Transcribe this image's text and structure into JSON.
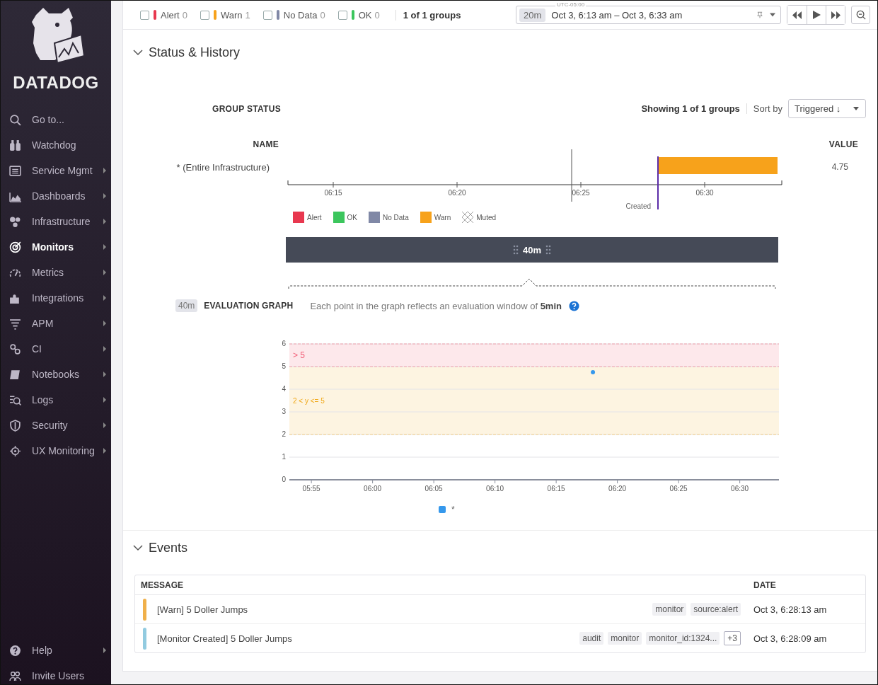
{
  "sidebar": {
    "logo_text": "DATADOG",
    "items": [
      {
        "label": "Go to...",
        "selected": false,
        "submenu": false
      },
      {
        "label": "Watchdog",
        "selected": false,
        "submenu": false
      },
      {
        "label": "Service Mgmt",
        "selected": false,
        "submenu": true
      },
      {
        "label": "Dashboards",
        "selected": false,
        "submenu": true
      },
      {
        "label": "Infrastructure",
        "selected": false,
        "submenu": true
      },
      {
        "label": "Monitors",
        "selected": true,
        "submenu": true
      },
      {
        "label": "Metrics",
        "selected": false,
        "submenu": true
      },
      {
        "label": "Integrations",
        "selected": false,
        "submenu": true
      },
      {
        "label": "APM",
        "selected": false,
        "submenu": true
      },
      {
        "label": "CI",
        "selected": false,
        "submenu": true
      },
      {
        "label": "Notebooks",
        "selected": false,
        "submenu": true
      },
      {
        "label": "Logs",
        "selected": false,
        "submenu": true
      },
      {
        "label": "Security",
        "selected": false,
        "submenu": true
      },
      {
        "label": "UX Monitoring",
        "selected": false,
        "submenu": true
      }
    ],
    "bottom_items": [
      {
        "label": "Help",
        "selected": false,
        "submenu": true
      },
      {
        "label": "Invite Users",
        "selected": false,
        "submenu": false
      }
    ]
  },
  "toolbar": {
    "filters": [
      {
        "label": "Alert",
        "count": "0",
        "checked": false,
        "color": "#e8384f"
      },
      {
        "label": "Warn",
        "count": "1",
        "checked": false,
        "color": "#f7a21b"
      },
      {
        "label": "No Data",
        "count": "0",
        "checked": false,
        "color": "#8088a6"
      },
      {
        "label": "OK",
        "count": "0",
        "checked": false,
        "color": "#3cc65d"
      }
    ],
    "groups": "1 of 1 groups",
    "timeframe": {
      "badge": "20m",
      "timezone": "UTC-05:00",
      "range": "Oct 3, 6:13 am – Oct 3, 6:33 am"
    }
  },
  "status_history": {
    "title": "Status & History",
    "expanded": true,
    "group_status": "GROUP STATUS",
    "showing": "Showing 1 of 1 groups",
    "sort_label": "Sort by",
    "sort_value": "Triggered ↓",
    "name_header": "NAME",
    "value_header": "VALUE",
    "groups": [
      {
        "name": "* (Entire Infrastructure)",
        "value": "4.75",
        "color": "#f7a21b"
      }
    ],
    "axis_ticks": [
      "06:15",
      "06:20",
      "06:25",
      "06:30"
    ],
    "created_label": "Created",
    "legend": [
      {
        "label": "Alert",
        "kind": "solid",
        "color": "#e8384f"
      },
      {
        "label": "OK",
        "kind": "solid",
        "color": "#3cc65d"
      },
      {
        "label": "No Data",
        "kind": "solid",
        "color": "#8088a6"
      },
      {
        "label": "Warn",
        "kind": "solid",
        "color": "#f7a21b"
      },
      {
        "label": "Muted",
        "kind": "hatched"
      }
    ],
    "range_bar": "40m",
    "evaluation": {
      "badge": "40m",
      "title": "EVALUATION GRAPH",
      "note": "Each point in the graph reflects an evaluation window of **5min**",
      "chart_data": {
        "type": "scatter",
        "categories": [
          null,
          "05:55",
          null,
          null,
          null,
          null,
          "06:00",
          null,
          null,
          null,
          null,
          "06:05",
          null,
          null,
          null,
          null,
          "06:10",
          null,
          null,
          null,
          null,
          "06:15",
          null,
          null,
          null,
          null,
          "06:20",
          null,
          null,
          null,
          null,
          "06:25",
          null,
          null,
          null,
          null,
          "06:30",
          null,
          null,
          null
        ],
        "series": [
          {
            "name": "*",
            "color": "#3598ec",
            "values": [
              null,
              null,
              null,
              null,
              null,
              null,
              null,
              null,
              null,
              null,
              null,
              null,
              null,
              null,
              null,
              null,
              null,
              null,
              null,
              null,
              null,
              null,
              null,
              null,
              4.75,
              null,
              null,
              null,
              null,
              null,
              null,
              null,
              null,
              null,
              null,
              null,
              null,
              null,
              null,
              null
            ]
          }
        ],
        "ylim": [
          0,
          6
        ],
        "yticks": [
          0,
          1,
          2,
          3,
          4,
          5,
          6
        ],
        "grid": true,
        "bands": [
          {
            "axis": "y",
            "from": 5,
            "to": 6,
            "label": "> 5",
            "color": "#fde8eb"
          },
          {
            "axis": "y",
            "from": 2,
            "to": 5,
            "label": "2 < y <= 5",
            "color": "#fdf4e1"
          }
        ],
        "ref_lines": [
          {
            "axis": "y",
            "value": 6,
            "color": "#f2a0ad"
          },
          {
            "axis": "y",
            "value": 5,
            "color": "#f2a0ad"
          },
          {
            "axis": "y",
            "value": 2,
            "color": "#f5cf85"
          }
        ]
      }
    }
  },
  "events": {
    "title": "Events",
    "expanded": true,
    "columns": [
      "MESSAGE",
      "DATE"
    ],
    "rows": [
      {
        "message": "[Warn] 5 Doller Jumps",
        "color": "#f0b04a",
        "tags": [
          {
            "text": "monitor",
            "kind": "tag"
          },
          {
            "text": "source:alert",
            "kind": "tag"
          }
        ],
        "date": "Oct 3, 6:28:13 am"
      },
      {
        "message": "[Monitor Created] 5 Doller Jumps",
        "color": "#92cbe0",
        "tags": [
          {
            "text": "audit",
            "kind": "tag"
          },
          {
            "text": "monitor",
            "kind": "tag"
          },
          {
            "text": "monitor_id:1324...",
            "kind": "tag"
          },
          {
            "text": "+3",
            "kind": "more"
          }
        ],
        "date": "Oct 3, 6:28:09 am"
      }
    ]
  }
}
